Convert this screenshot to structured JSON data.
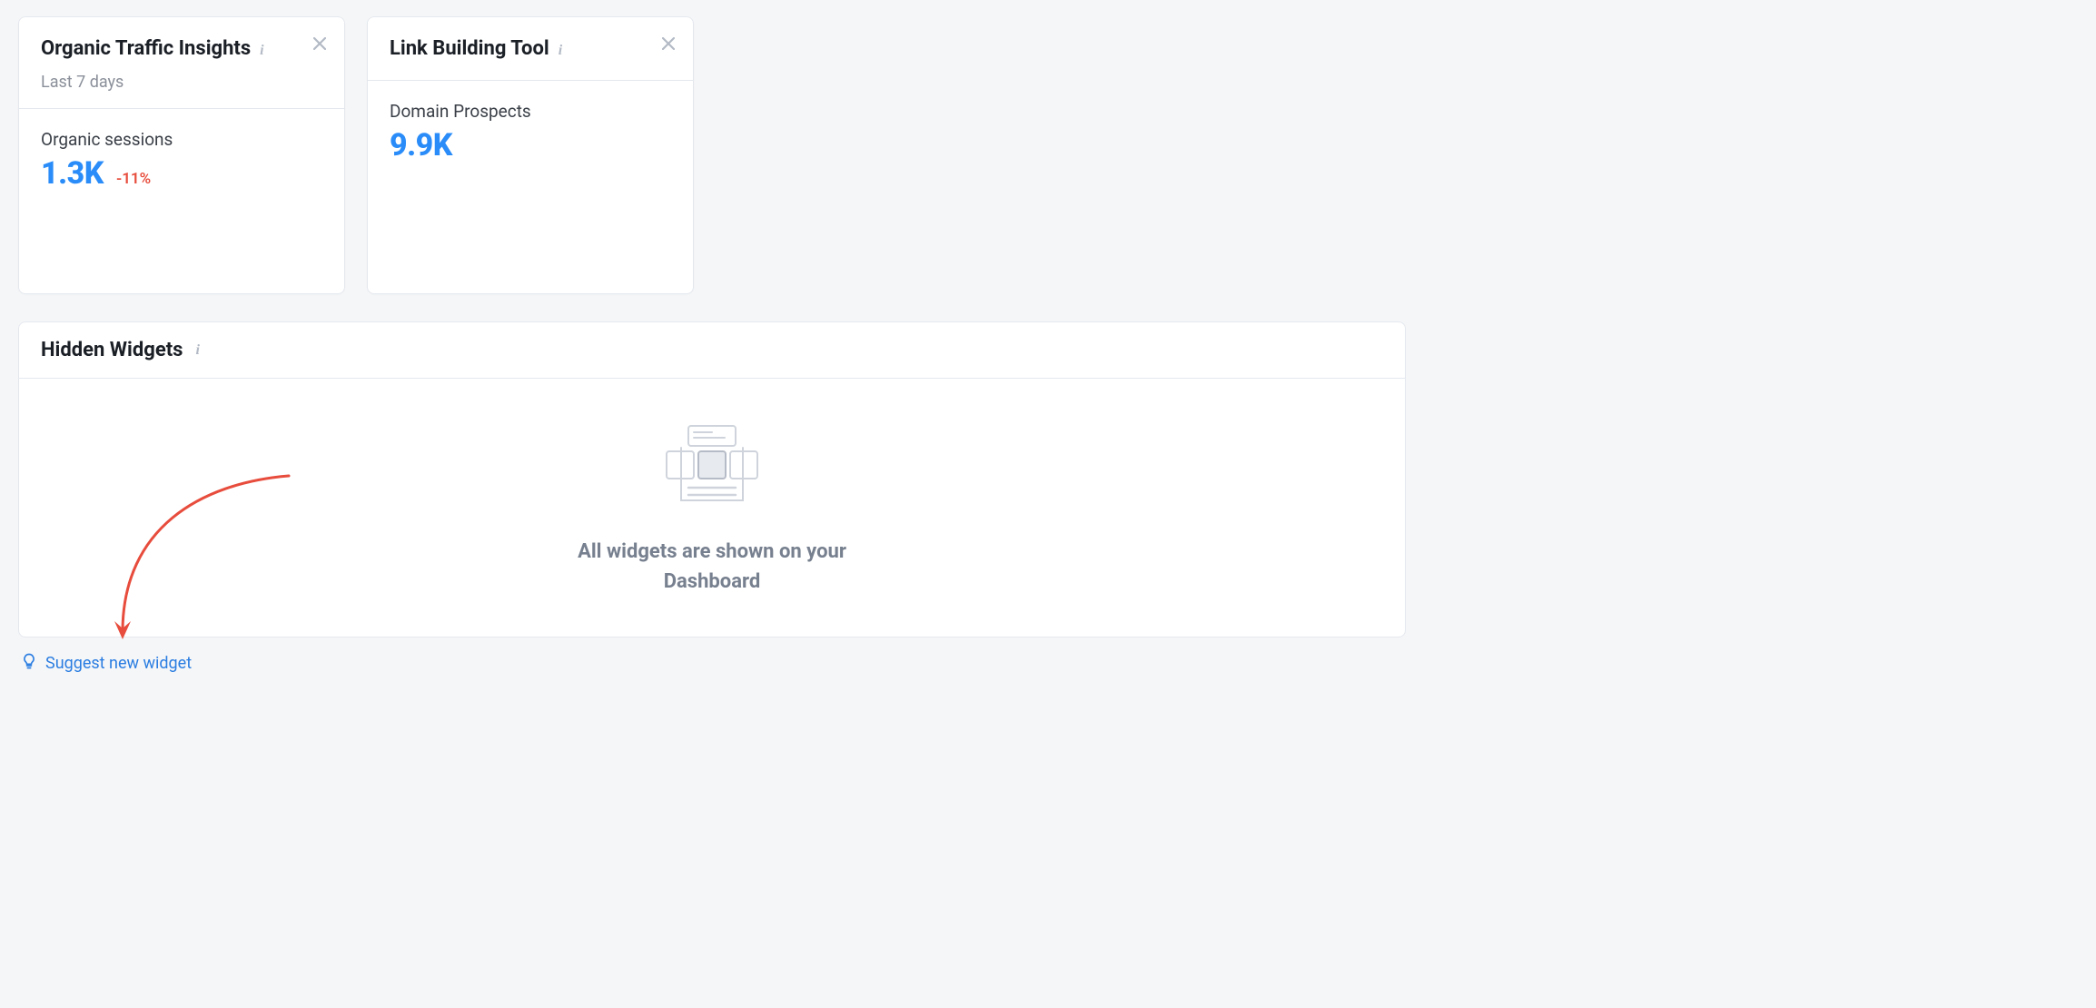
{
  "widgets": [
    {
      "title": "Organic Traffic Insights",
      "subtitle": "Last 7 days",
      "metric_label": "Organic sessions",
      "metric_value": "1.3K",
      "metric_delta": "-11%"
    },
    {
      "title": "Link Building Tool",
      "metric_label": "Domain Prospects",
      "metric_value": "9.9K"
    }
  ],
  "hidden_panel": {
    "title": "Hidden Widgets",
    "empty_line1": "All widgets are shown on your",
    "empty_line2": "Dashboard"
  },
  "suggest_link": "Suggest new widget",
  "icons": {
    "info": "i",
    "close": "close",
    "lightbulb": "lightbulb"
  }
}
